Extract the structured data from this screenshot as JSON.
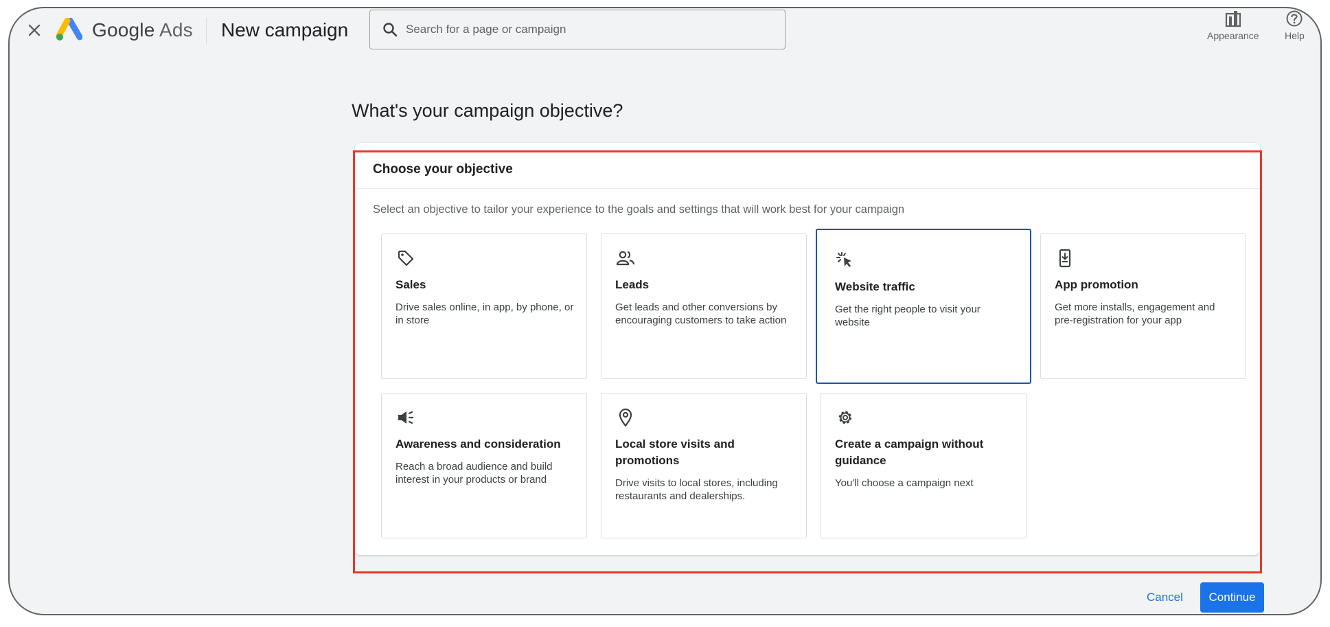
{
  "header": {
    "brand_google": "Google",
    "brand_ads": "Ads",
    "page_name": "New campaign",
    "search_placeholder": "Search for a page or campaign",
    "tools": [
      {
        "label": "Appearance",
        "icon": "appearance-icon"
      },
      {
        "label": "Help",
        "icon": "help-icon"
      }
    ]
  },
  "main": {
    "question": "What's your campaign objective?",
    "card_title": "Choose your objective",
    "card_subtitle": "Select an objective to tailor your experience to the goals and settings that will work best for your campaign",
    "objectives": [
      {
        "title": "Sales",
        "description": "Drive sales online, in app, by phone, or in store",
        "icon": "tag-icon",
        "selected": false
      },
      {
        "title": "Leads",
        "description": "Get leads and other conversions by encouraging customers to take action",
        "icon": "people-icon",
        "selected": false
      },
      {
        "title": "Website traffic",
        "description": "Get the right people to visit your website",
        "icon": "cursor-click-icon",
        "selected": true
      },
      {
        "title": "App promotion",
        "description": "Get more installs, engagement and pre-registration for your app",
        "icon": "phone-download-icon",
        "selected": false
      },
      {
        "title": "Awareness and consideration",
        "description": "Reach a broad audience and build interest in your products or brand",
        "icon": "megaphone-icon",
        "selected": false
      },
      {
        "title": "Local store visits and promotions",
        "description": "Drive visits to local stores, including restaurants and dealerships.",
        "icon": "location-pin-icon",
        "selected": false
      },
      {
        "title": "Create a campaign without guidance",
        "description": "You'll choose a campaign next",
        "icon": "gear-icon",
        "selected": false
      }
    ]
  },
  "footer": {
    "cancel_label": "Cancel",
    "continue_label": "Continue"
  },
  "colors": {
    "accent": "#1a73e8",
    "selected_border": "#1a56a8",
    "highlight": "#e8372a"
  }
}
